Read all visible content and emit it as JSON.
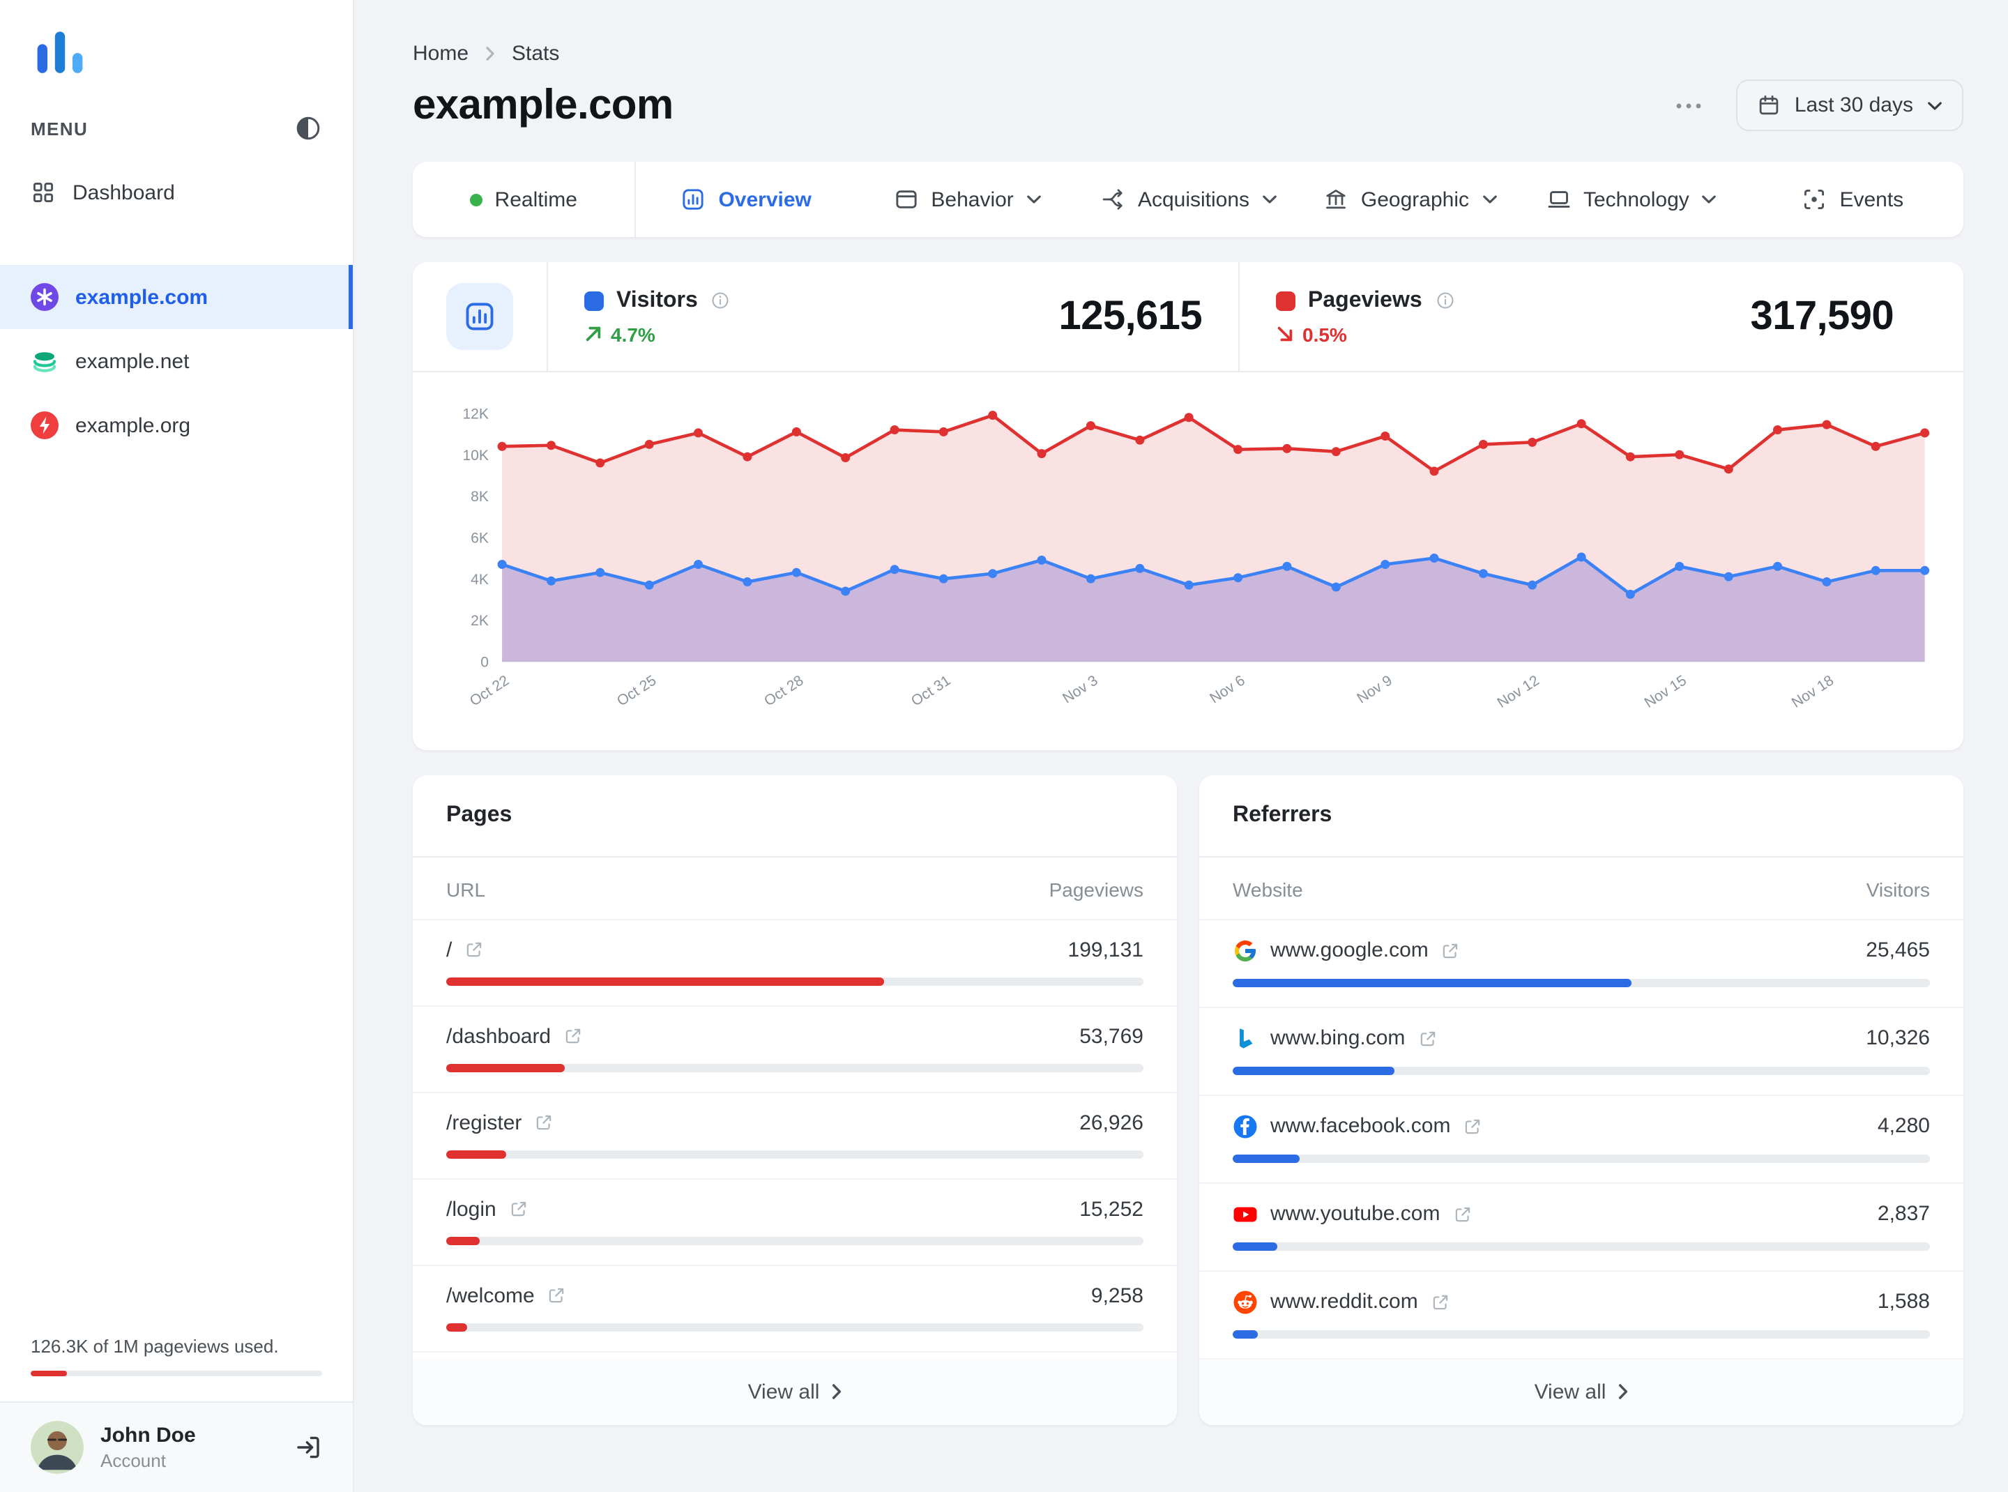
{
  "colors": {
    "accent-blue": "#2b6be4",
    "accent-red": "#e03131",
    "accent-green": "#2f9e44"
  },
  "sidebar": {
    "menu_label": "MENU",
    "nav": [
      {
        "label": "Dashboard",
        "icon": "dashboard-grid"
      }
    ],
    "sites": [
      {
        "label": "example.com",
        "icon": "site-purple",
        "active": true
      },
      {
        "label": "example.net",
        "icon": "site-teal",
        "active": false
      },
      {
        "label": "example.org",
        "icon": "site-red",
        "active": false
      }
    ],
    "usage": {
      "text": "126.3K of 1M pageviews used.",
      "percent": 12.6
    },
    "user": {
      "name": "John Doe",
      "role": "Account"
    }
  },
  "header": {
    "breadcrumb_home": "Home",
    "breadcrumb_current": "Stats",
    "title": "example.com",
    "date_range_label": "Last 30 days"
  },
  "tabs": [
    {
      "label": "Realtime",
      "icon": "realtime-dot",
      "active": false,
      "dropdown": false,
      "divider": true
    },
    {
      "label": "Overview",
      "icon": "overview",
      "active": true,
      "dropdown": false
    },
    {
      "label": "Behavior",
      "icon": "behavior",
      "active": false,
      "dropdown": true
    },
    {
      "label": "Acquisitions",
      "icon": "acquisitions",
      "active": false,
      "dropdown": true
    },
    {
      "label": "Geographic",
      "icon": "geographic",
      "active": false,
      "dropdown": true
    },
    {
      "label": "Technology",
      "icon": "technology",
      "active": false,
      "dropdown": true
    },
    {
      "label": "Events",
      "icon": "events",
      "active": false,
      "dropdown": false
    }
  ],
  "stats": {
    "visitors": {
      "label": "Visitors",
      "value": 125615,
      "value_display": "125,615",
      "change": "4.7%",
      "trend": "up",
      "color": "#2b6be4"
    },
    "pageviews": {
      "label": "Pageviews",
      "value": 317590,
      "value_display": "317,590",
      "change": "0.5%",
      "trend": "down",
      "color": "#e03131"
    }
  },
  "chart_data": {
    "type": "area",
    "x": [
      "Oct 22",
      "Oct 23",
      "Oct 24",
      "Oct 25",
      "Oct 26",
      "Oct 27",
      "Oct 28",
      "Oct 29",
      "Oct 30",
      "Oct 31",
      "Nov 1",
      "Nov 2",
      "Nov 3",
      "Nov 4",
      "Nov 5",
      "Nov 6",
      "Nov 7",
      "Nov 8",
      "Nov 9",
      "Nov 10",
      "Nov 11",
      "Nov 12",
      "Nov 13",
      "Nov 14",
      "Nov 15",
      "Nov 16",
      "Nov 17",
      "Nov 18",
      "Nov 19",
      "Nov 20"
    ],
    "x_label_every": 3,
    "ylim": [
      0,
      12000
    ],
    "yticks": [
      "0",
      "2K",
      "4K",
      "6K",
      "8K",
      "10K",
      "12K"
    ],
    "grid": false,
    "legend": "in-header",
    "series": [
      {
        "name": "Pageviews",
        "color": "#e03131",
        "fill": "rgba(224,49,49,0.14)",
        "values": [
          10400,
          10450,
          9600,
          10500,
          11050,
          9900,
          11100,
          9850,
          11200,
          11100,
          11900,
          10050,
          11400,
          10700,
          11800,
          10250,
          10300,
          10150,
          10900,
          9200,
          10500,
          10600,
          11500,
          9900,
          10000,
          9300,
          11200,
          11450,
          10400,
          11050
        ]
      },
      {
        "name": "Visitors",
        "color": "#3b82f6",
        "fill": "rgba(97,83,205,0.30)",
        "values": [
          4700,
          3900,
          4300,
          3700,
          4700,
          3850,
          4300,
          3400,
          4450,
          4000,
          4250,
          4900,
          4000,
          4500,
          3700,
          4050,
          4600,
          3600,
          4700,
          5000,
          4250,
          3700,
          5050,
          3250,
          4600,
          4100,
          4600,
          3850,
          4400,
          4400
        ]
      }
    ]
  },
  "pages": {
    "title": "Pages",
    "col_url": "URL",
    "col_value": "Pageviews",
    "view_all": "View all",
    "rows": [
      {
        "url": "/",
        "value": 199131,
        "display": "199,131"
      },
      {
        "url": "/dashboard",
        "value": 53769,
        "display": "53,769"
      },
      {
        "url": "/register",
        "value": 26926,
        "display": "26,926"
      },
      {
        "url": "/login",
        "value": 15252,
        "display": "15,252"
      },
      {
        "url": "/welcome",
        "value": 9258,
        "display": "9,258"
      }
    ]
  },
  "referrers": {
    "title": "Referrers",
    "col_site": "Website",
    "col_value": "Visitors",
    "view_all": "View all",
    "rows": [
      {
        "site": "www.google.com",
        "icon": "google",
        "value": 25465,
        "display": "25,465"
      },
      {
        "site": "www.bing.com",
        "icon": "bing",
        "value": 10326,
        "display": "10,326"
      },
      {
        "site": "www.facebook.com",
        "icon": "facebook",
        "value": 4280,
        "display": "4,280"
      },
      {
        "site": "www.youtube.com",
        "icon": "youtube",
        "value": 2837,
        "display": "2,837"
      },
      {
        "site": "www.reddit.com",
        "icon": "reddit",
        "value": 1588,
        "display": "1,588"
      }
    ]
  }
}
